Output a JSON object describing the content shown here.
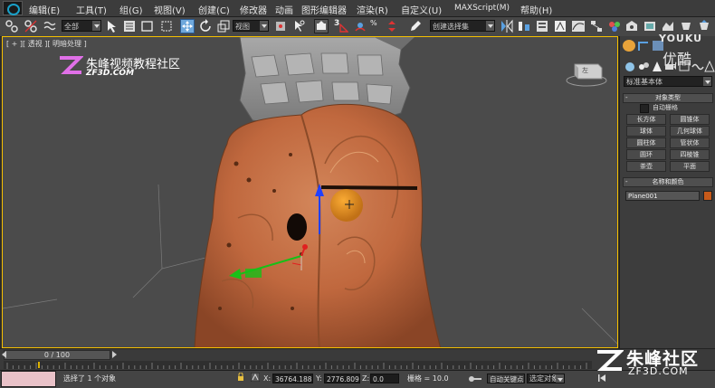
{
  "menu": {
    "items": [
      "编辑(E)",
      "工具(T)",
      "组(G)",
      "视图(V)",
      "创建(C)",
      "修改器",
      "动画",
      "图形编辑器",
      "渲染(R)",
      "自定义(U)",
      "MAXScript(M)",
      "帮助(H)"
    ]
  },
  "toolbar": {
    "selection_filter": "全部",
    "reference_coord": "视图",
    "named_selection": "创建选择集",
    "snap_label": "3"
  },
  "viewport": {
    "label": "[ + ][ 透视 ][ 明暗处理 ]",
    "viewcube_label": "左"
  },
  "watermark": {
    "top_left_title": "朱峰视频教程社区",
    "top_left_url": "ZF3D.COM",
    "bottom_right_title": "朱峰社区",
    "bottom_right_url": "ZF3D.COM",
    "youku_en": "YOUKU",
    "youku_cn": "优酷"
  },
  "command_panel": {
    "category_dropdown": "标准基本体",
    "object_type_title": "对象类型",
    "autogrid_label": "自动栅格",
    "object_buttons": [
      "长方体",
      "圆锥体",
      "球体",
      "几何球体",
      "圆柱体",
      "管状体",
      "圆环",
      "四棱锥",
      "茶壶",
      "平面"
    ],
    "name_color_title": "名称和颜色",
    "object_name": "Plane001",
    "object_color": "#c75a1a"
  },
  "timeline": {
    "slider_label": "0 / 100"
  },
  "status": {
    "selection_text": "选择了 1 个对象",
    "x_label": "X:",
    "x_value": "36764.188",
    "y_label": "Y:",
    "y_value": "2776.809",
    "z_label": "Z:",
    "z_value": "0.0",
    "grid_label": "栅格 = 10.0",
    "autokey_label": "自动关键点",
    "selected_object_dropdown": "选定对象"
  },
  "colors": {
    "viewport_active_border": "#f5c000",
    "gizmo_x": "#e02020",
    "gizmo_y": "#18c018",
    "gizmo_z": "#2040ff",
    "model_terracotta": "#c8764a",
    "model_stone": "#9a9a9a",
    "maxscript_box": "#e9c2c8"
  }
}
